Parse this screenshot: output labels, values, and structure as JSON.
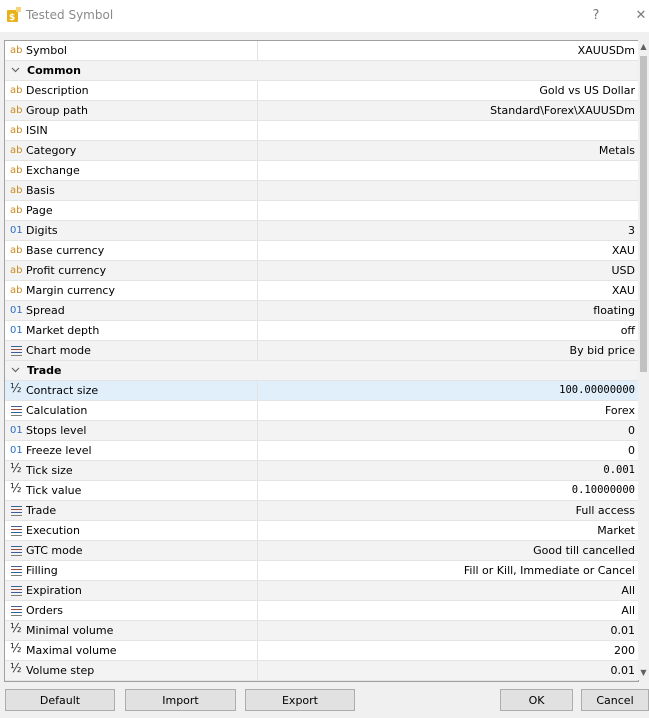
{
  "window": {
    "title": "Tested Symbol",
    "help_glyph": "?",
    "close_glyph": "✕"
  },
  "symbol_row": {
    "label": "Symbol",
    "value": "XAUUSDm",
    "icon": "text-icon"
  },
  "sections": {
    "common": "Common",
    "trade": "Trade"
  },
  "common_rows": [
    {
      "label": "Description",
      "value": "Gold vs US Dollar",
      "icon": "ab"
    },
    {
      "label": "Group path",
      "value": "Standard\\Forex\\XAUUSDm",
      "icon": "ab"
    },
    {
      "label": "ISIN",
      "value": "",
      "icon": "ab"
    },
    {
      "label": "Category",
      "value": "Metals",
      "icon": "ab"
    },
    {
      "label": "Exchange",
      "value": "",
      "icon": "ab"
    },
    {
      "label": "Basis",
      "value": "",
      "icon": "ab"
    },
    {
      "label": "Page",
      "value": "",
      "icon": "ab"
    },
    {
      "label": "Digits",
      "value": "3",
      "icon": "01"
    },
    {
      "label": "Base currency",
      "value": "XAU",
      "icon": "ab"
    },
    {
      "label": "Profit currency",
      "value": "USD",
      "icon": "ab"
    },
    {
      "label": "Margin currency",
      "value": "XAU",
      "icon": "ab"
    },
    {
      "label": "Spread",
      "value": "floating",
      "icon": "01"
    },
    {
      "label": "Market depth",
      "value": "off",
      "icon": "01"
    },
    {
      "label": "Chart mode",
      "value": "By bid price",
      "icon": "list"
    }
  ],
  "trade_rows": [
    {
      "label": "Contract size",
      "value": "100.00000000",
      "icon": "half"
    },
    {
      "label": "Calculation",
      "value": "Forex",
      "icon": "list"
    },
    {
      "label": "Stops level",
      "value": "0",
      "icon": "01"
    },
    {
      "label": "Freeze level",
      "value": "0",
      "icon": "01"
    },
    {
      "label": "Tick size",
      "value": "0.001",
      "icon": "half"
    },
    {
      "label": "Tick value",
      "value": "0.10000000",
      "icon": "half"
    },
    {
      "label": "Trade",
      "value": "Full access",
      "icon": "list"
    },
    {
      "label": "Execution",
      "value": "Market",
      "icon": "list"
    },
    {
      "label": "GTC mode",
      "value": "Good till cancelled",
      "icon": "list"
    },
    {
      "label": "Filling",
      "value": "Fill or Kill, Immediate or Cancel",
      "icon": "list"
    },
    {
      "label": "Expiration",
      "value": "All",
      "icon": "list"
    },
    {
      "label": "Orders",
      "value": "All",
      "icon": "list"
    },
    {
      "label": "Minimal volume",
      "value": "0.01",
      "icon": "half"
    },
    {
      "label": "Maximal volume",
      "value": "200",
      "icon": "half"
    },
    {
      "label": "Volume step",
      "value": "0.01",
      "icon": "half"
    }
  ],
  "icon_glyphs": {
    "ab": "ab",
    "01": "01",
    "half": "½"
  },
  "selected_row": "Contract size",
  "buttons": {
    "default": "Default",
    "import": "Import",
    "export": "Export",
    "ok": "OK",
    "cancel": "Cancel"
  },
  "scrollbar": {
    "up_glyph": "▲",
    "down_glyph": "▼"
  },
  "colors": {
    "selection": "#e1effa",
    "text_icon": "#c98a1f",
    "numeric_icon": "#2a6fbd"
  }
}
